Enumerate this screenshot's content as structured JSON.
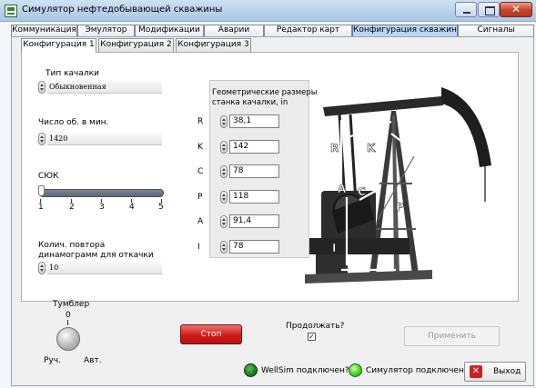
{
  "window": {
    "title": "Симулятор нефтедобывающей скважины",
    "close_glyph": "✕"
  },
  "tabs": [
    {
      "label": "Коммуникация"
    },
    {
      "label": "Эмулятор"
    },
    {
      "label": "Модификации"
    },
    {
      "label": "Аварии"
    },
    {
      "label": "Редактор карт"
    },
    {
      "label": "Конфигурация скважины",
      "active": true
    },
    {
      "label": "Сигналы"
    }
  ],
  "subtabs": [
    {
      "label": "Конфигурация 1",
      "active": true
    },
    {
      "label": "Конфигурация 2"
    },
    {
      "label": "Конфигурация 3"
    }
  ],
  "pump_type": {
    "label": "Тип качалки",
    "value": "Обыкновенная"
  },
  "strokes_per_min": {
    "label": "Число об. в мин.",
    "value": "1420"
  },
  "sjuk": {
    "label": "СЮК",
    "value": 1,
    "ticks": [
      "1",
      "2",
      "3",
      "4",
      "5"
    ]
  },
  "dynamogram_repeats": {
    "label": "Колич. повтора динамограмм для откачки",
    "value": "10"
  },
  "geometry": {
    "title": "Геометрические размеры станка качалки, in",
    "fields": [
      {
        "label": "R",
        "value": "38,1"
      },
      {
        "label": "K",
        "value": "142"
      },
      {
        "label": "C",
        "value": "78"
      },
      {
        "label": "P",
        "value": "118"
      },
      {
        "label": "A",
        "value": "91,4"
      },
      {
        "label": "I",
        "value": "78"
      }
    ]
  },
  "diagram_labels": {
    "R": "R",
    "A": "A",
    "C": "C",
    "I": "I",
    "P": "P",
    "K": "K"
  },
  "toggle": {
    "label": "Тумблер",
    "center": "0",
    "left": "Руч.",
    "right": "Авт."
  },
  "stop_button": {
    "label": "Стоп"
  },
  "continue": {
    "label": "Продолжать?",
    "checked_glyph": "✓",
    "checked": true
  },
  "apply_button": {
    "label": "Применить"
  },
  "status": {
    "wellsim": "WellSim подключен?",
    "simulator": "Симулятор подключен?"
  },
  "exit_button": {
    "label": "Выход",
    "icon_glyph": "✕"
  },
  "colors": {
    "stop": "#d01a1a",
    "led_dark": "#1c7a1c",
    "led_bright": "#46d12a",
    "active_tab": "#bcd6f0"
  }
}
